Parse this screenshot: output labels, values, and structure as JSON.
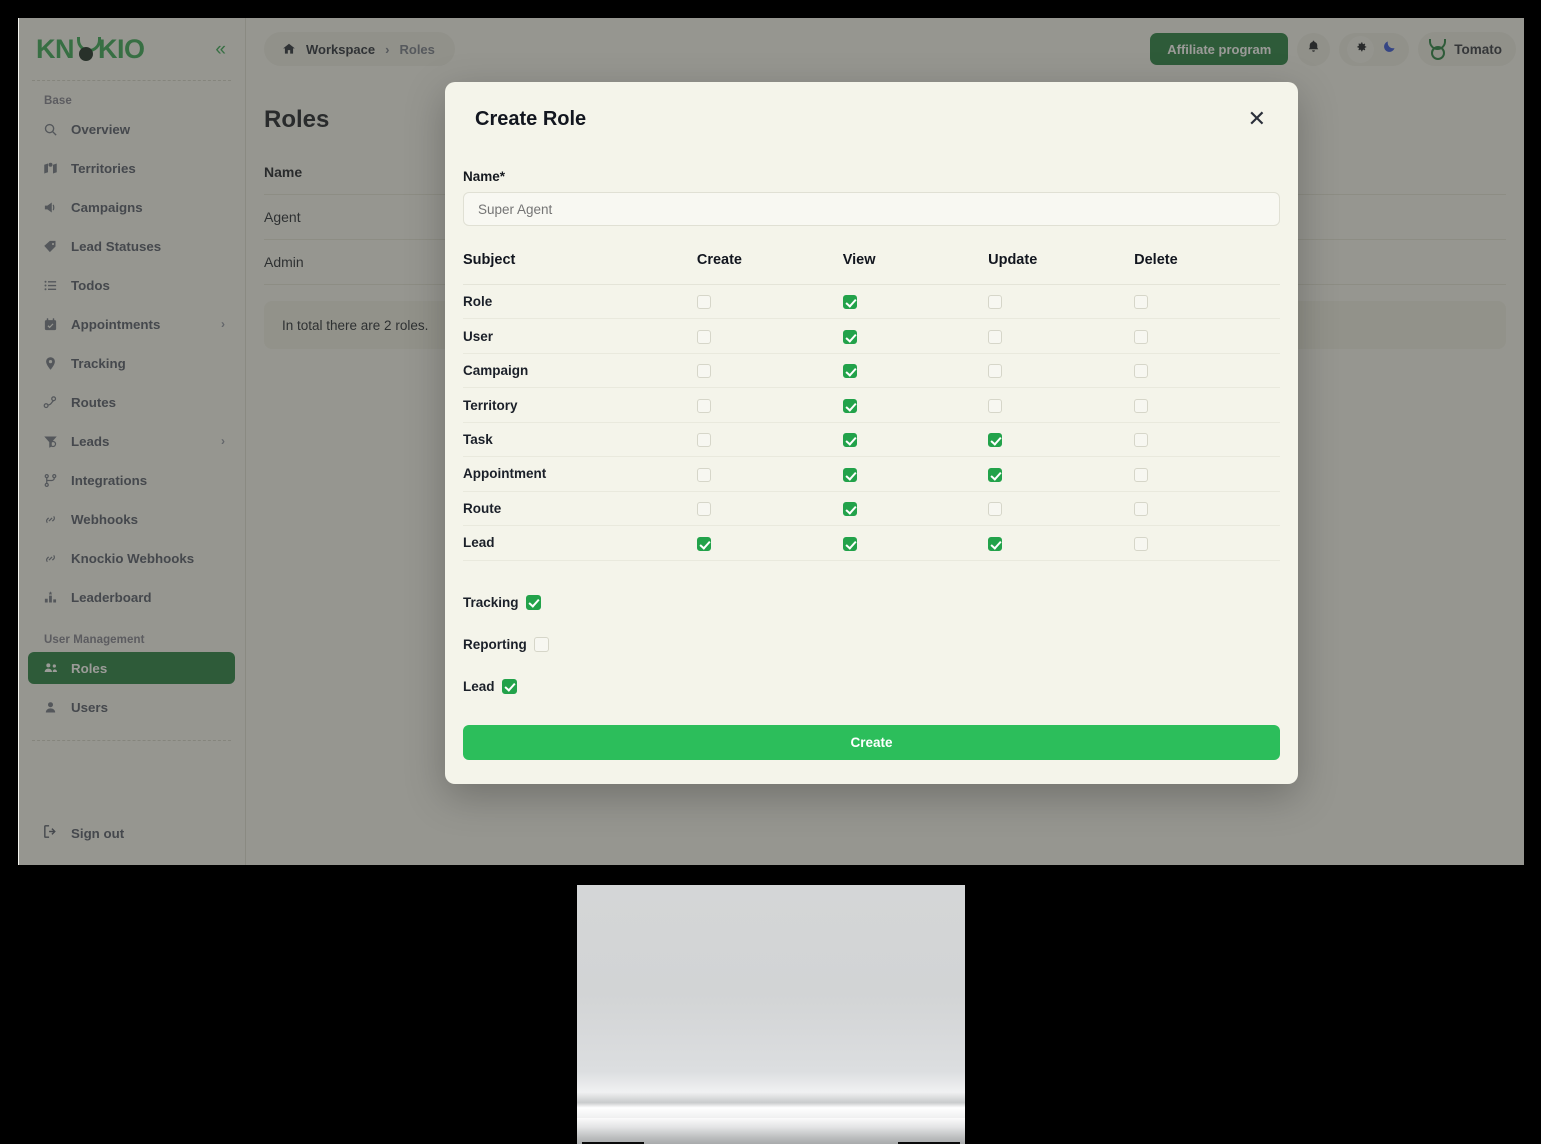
{
  "app": {
    "brand": {
      "part1": "KN",
      "part2": "KIO",
      "mark": "bull-logo"
    },
    "collapse_label": "«"
  },
  "sidebar": {
    "sections": [
      {
        "label": "Base",
        "items": [
          {
            "label": "Overview",
            "icon": "search-icon",
            "has_chevron": false
          },
          {
            "label": "Territories",
            "icon": "map-icon",
            "has_chevron": false
          },
          {
            "label": "Campaigns",
            "icon": "megaphone-icon",
            "has_chevron": false
          },
          {
            "label": "Lead Statuses",
            "icon": "tag-icon",
            "has_chevron": false
          },
          {
            "label": "Todos",
            "icon": "list-icon",
            "has_chevron": false
          },
          {
            "label": "Appointments",
            "icon": "calendar-icon",
            "has_chevron": true
          },
          {
            "label": "Tracking",
            "icon": "pin-icon",
            "has_chevron": false
          },
          {
            "label": "Routes",
            "icon": "route-icon",
            "has_chevron": false
          },
          {
            "label": "Leads",
            "icon": "funnel-icon",
            "has_chevron": true
          },
          {
            "label": "Integrations",
            "icon": "branch-icon",
            "has_chevron": false
          },
          {
            "label": "Webhooks",
            "icon": "link-icon",
            "has_chevron": false
          },
          {
            "label": "Knockio Webhooks",
            "icon": "link-icon",
            "has_chevron": false
          },
          {
            "label": "Leaderboard",
            "icon": "chart-icon",
            "has_chevron": false
          }
        ]
      },
      {
        "label": "User Management",
        "items": [
          {
            "label": "Roles",
            "icon": "users-icon",
            "has_chevron": false,
            "active": true
          },
          {
            "label": "Users",
            "icon": "user-icon",
            "has_chevron": false
          }
        ]
      }
    ],
    "sign_out": {
      "label": "Sign out",
      "icon": "logout-icon"
    },
    "chevron_glyph": "›",
    "active_color": "#1d7a3a"
  },
  "topbar": {
    "breadcrumb": {
      "home_icon": "home-icon",
      "root": "Workspace",
      "separator": "›",
      "current": "Roles"
    },
    "affiliate_label": "Affiliate program",
    "icons": [
      {
        "name": "bell-icon"
      },
      {
        "name": "gear-icon"
      },
      {
        "name": "moon-icon"
      }
    ],
    "user": {
      "name": "Tomato",
      "avatar": "bull-avatar"
    },
    "accent_color": "#1d7a3a"
  },
  "page": {
    "title": "Roles",
    "table": {
      "columns": [
        "Name"
      ],
      "rows": [
        [
          "Agent"
        ],
        [
          "Admin"
        ]
      ]
    },
    "footer_text": "In total there are 2 roles."
  },
  "modal": {
    "title": "Create Role",
    "close_glyph": "✕",
    "name_field": {
      "label": "Name*",
      "value": "Super Agent",
      "placeholder": "Super Agent"
    },
    "permissions": {
      "columns": [
        "Subject",
        "Create",
        "View",
        "Update",
        "Delete"
      ],
      "rows": [
        {
          "subject": "Role",
          "create": false,
          "view": true,
          "update": false,
          "delete": false
        },
        {
          "subject": "User",
          "create": false,
          "view": true,
          "update": false,
          "delete": false
        },
        {
          "subject": "Campaign",
          "create": false,
          "view": true,
          "update": false,
          "delete": false
        },
        {
          "subject": "Territory",
          "create": false,
          "view": true,
          "update": false,
          "delete": false
        },
        {
          "subject": "Task",
          "create": false,
          "view": true,
          "update": true,
          "delete": false
        },
        {
          "subject": "Appointment",
          "create": false,
          "view": true,
          "update": true,
          "delete": false
        },
        {
          "subject": "Route",
          "create": false,
          "view": true,
          "update": false,
          "delete": false
        },
        {
          "subject": "Lead",
          "create": true,
          "view": true,
          "update": true,
          "delete": false
        }
      ]
    },
    "extras": [
      {
        "label": "Tracking",
        "checked": true
      },
      {
        "label": "Reporting",
        "checked": false
      },
      {
        "label": "Lead",
        "checked": true
      }
    ],
    "submit_label": "Create",
    "submit_color": "#2cbe5b",
    "checkbox_on_color": "#22a24a"
  }
}
